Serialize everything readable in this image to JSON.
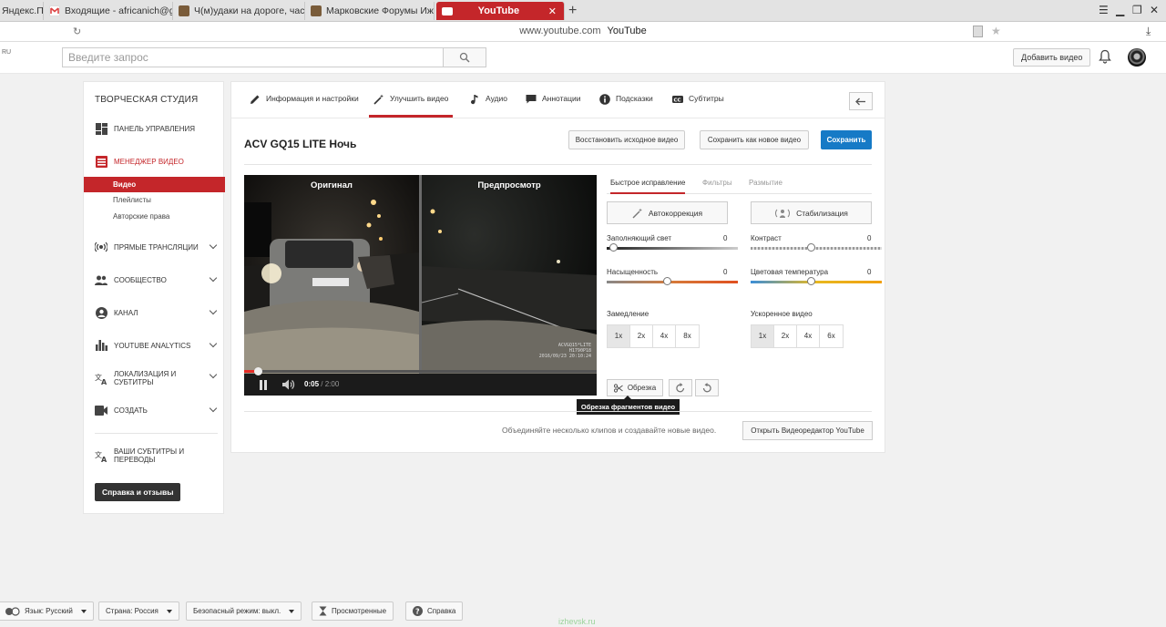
{
  "browser": {
    "tabs": [
      {
        "label": "Яндекс.По"
      },
      {
        "label": "Входящие - africanich@gm"
      },
      {
        "label": "Ч(м)удаки на дороге, част"
      },
      {
        "label": "Марковские Форумы Ижев"
      },
      {
        "label": "YouTube",
        "active": true
      }
    ],
    "address_host": "www.youtube.com",
    "address_title": "YouTube",
    "new_tab": "+"
  },
  "header": {
    "region": "RU",
    "search_placeholder": "Введите запрос",
    "upload_label": "Добавить видео"
  },
  "sidebar": {
    "title": "ТВОРЧЕСКАЯ СТУДИЯ",
    "dashboard": "ПАНЕЛЬ УПРАВЛЕНИЯ",
    "video_manager": "МЕНЕДЖЕР ВИДЕО",
    "sub_videos": "Видео",
    "sub_playlists": "Плейлисты",
    "sub_copyright": "Авторские права",
    "live": "ПРЯМЫЕ ТРАНСЛЯЦИИ",
    "community": "СООБЩЕСТВО",
    "channel": "КАНАЛ",
    "analytics": "YOUTUBE ANALYTICS",
    "localization_line1": "ЛОКАЛИЗАЦИЯ И",
    "localization_line2": "СУБТИТРЫ",
    "create": "СОЗДАТЬ",
    "translations_line1": "ВАШИ СУБТИТРЫ И",
    "translations_line2": "ПЕРЕВОДЫ",
    "help_button": "Справка и отзывы"
  },
  "editor": {
    "tabs": {
      "info": "Информация и настройки",
      "enhance": "Улучшить видео",
      "audio": "Аудио",
      "annotations": "Аннотации",
      "cards": "Подсказки",
      "subtitles": "Субтитры"
    },
    "video_title": "ACV GQ15 LITE Ночь",
    "revert_button": "Восстановить исходное видео",
    "save_as_new_button": "Сохранить как новое видео",
    "save_button": "Сохранить",
    "player": {
      "original_label": "Оригинал",
      "preview_label": "Предпросмотр",
      "current_time": "0:05",
      "duration": "/ 2:00",
      "progress": 0.04,
      "overlay_text_1": "ACVGQ15*LITE",
      "overlay_text_2": "H1790P18",
      "overlay_text_3": "2016/09/23 20:10:24"
    },
    "right_tabs": {
      "quick_fix": "Быстрое исправление",
      "filters": "Фильтры",
      "blur": "Размытие"
    },
    "autofix_button": "Автокоррекция",
    "stabilize_button": "Стабилизация",
    "sliders": {
      "fill_light": {
        "label": "Заполняющий свет",
        "value": "0",
        "level": 0.02
      },
      "contrast": {
        "label": "Контраст",
        "value": "0",
        "level": 0.46
      },
      "saturation": {
        "label": "Насыщенность",
        "value": "0",
        "level": 0.46
      },
      "color_temp": {
        "label": "Цветовая температура",
        "value": "0",
        "level": 0.46
      }
    },
    "slowmo": {
      "label": "Замедление",
      "options": [
        "1x",
        "2x",
        "4x",
        "8x"
      ],
      "selected": "1x"
    },
    "timelapse": {
      "label": "Ускоренное видео",
      "options": [
        "1x",
        "2x",
        "4x",
        "6x"
      ],
      "selected": "1x"
    },
    "trim_button": "Обрезка",
    "trim_tooltip": "Обрезка фрагментов видео",
    "combine_text": "Объединяйте несколько клипов и создавайте новые видео.",
    "open_editor_button": "Открыть Видеоредактор YouTube"
  },
  "footer": {
    "language": "Язык: Русский",
    "country": "Страна: Россия",
    "safety": "Безопасный режим: выкл.",
    "history": "Просмотренные",
    "help": "Справка"
  },
  "watermark": "izhevsk.ru",
  "colors": {
    "accent_red": "#c4262a",
    "save_blue": "#167ac6"
  }
}
